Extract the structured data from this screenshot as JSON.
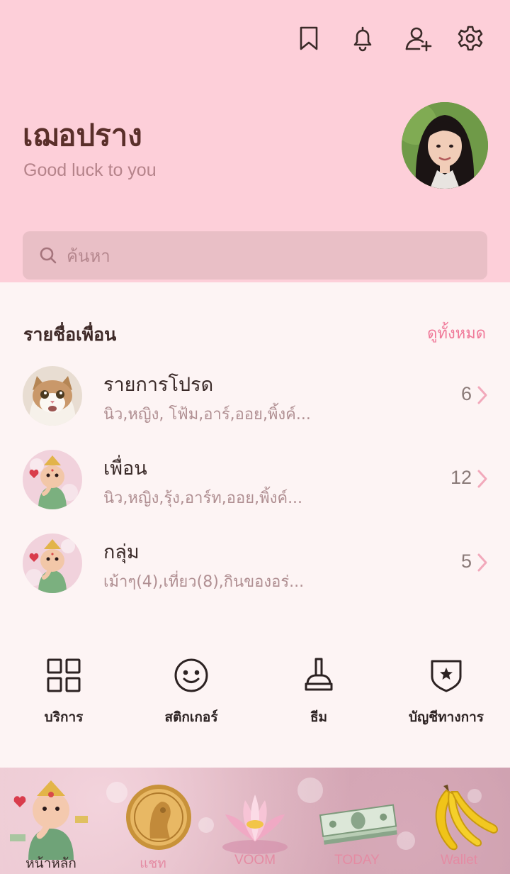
{
  "header": {
    "icons": [
      "bookmark-icon",
      "bell-icon",
      "add-friend-icon",
      "gear-icon"
    ]
  },
  "profile": {
    "name": "เฌอปราง",
    "status": "Good luck to you"
  },
  "search": {
    "placeholder": "ค้นหา"
  },
  "friends": {
    "title": "รายชื่อเพื่อน",
    "see_all": "ดูทั้งหมด",
    "rows": [
      {
        "title": "รายการโปรด",
        "subtitle": "นิว,หญิง, โฟ้ม,อาร์,ออย,พิ้งค์...",
        "count": "6"
      },
      {
        "title": "เพื่อน",
        "subtitle": "นิว,หญิง,รุ้ง,อาร์ท,ออย,พิ้งค์...",
        "count": "12"
      },
      {
        "title": "กลุ่ม",
        "subtitle": "เม้าๆ(4),เที่ยว(8),กินของอร่...",
        "count": "5"
      }
    ]
  },
  "shortcuts": [
    {
      "label": "บริการ",
      "icon": "grid-icon"
    },
    {
      "label": "สติกเกอร์",
      "icon": "smiley-icon"
    },
    {
      "label": "ธีม",
      "icon": "brush-icon"
    },
    {
      "label": "บัญชีทางการ",
      "icon": "shield-star-icon"
    }
  ],
  "tabs": [
    {
      "label": "หน้าหลัก",
      "icon": "ganesha-icon"
    },
    {
      "label": "แชท",
      "icon": "gold-coin-icon"
    },
    {
      "label": "VOOM",
      "icon": "lotus-icon"
    },
    {
      "label": "TODAY",
      "icon": "money-stack-icon"
    },
    {
      "label": "Wallet",
      "icon": "banana-icon"
    }
  ],
  "colors": {
    "header_bg": "#fdcfd9",
    "accent": "#f07a9a",
    "body_bg": "#fdf4f4"
  }
}
